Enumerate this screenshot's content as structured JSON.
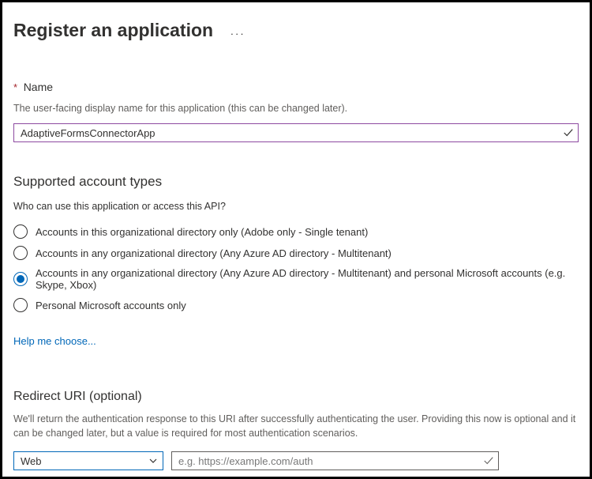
{
  "header": {
    "title": "Register an application"
  },
  "name": {
    "label": "Name",
    "helper": "The user-facing display name for this application (this can be changed later).",
    "value": "AdaptiveFormsConnectorApp"
  },
  "accountTypes": {
    "heading": "Supported account types",
    "question": "Who can use this application or access this API?",
    "selectedIndex": 2,
    "options": [
      "Accounts in this organizational directory only (Adobe only - Single tenant)",
      "Accounts in any organizational directory (Any Azure AD directory - Multitenant)",
      "Accounts in any organizational directory (Any Azure AD directory - Multitenant) and personal Microsoft accounts (e.g. Skype, Xbox)",
      "Personal Microsoft accounts only"
    ],
    "helpLink": "Help me choose..."
  },
  "redirect": {
    "heading": "Redirect URI (optional)",
    "helper": "We'll return the authentication response to this URI after successfully authenticating the user. Providing this now is optional and it can be changed later, but a value is required for most authentication scenarios.",
    "platformSelected": "Web",
    "uriPlaceholder": "e.g. https://example.com/auth",
    "uriValue": ""
  }
}
